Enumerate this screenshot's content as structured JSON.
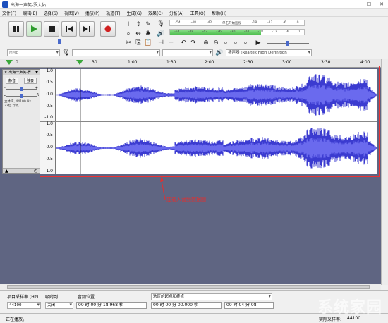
{
  "window": {
    "title": "出海一声笑-罗大佑"
  },
  "menu": [
    "文件(F)",
    "编辑(E)",
    "选择(S)",
    "视图(V)",
    "播放(P)",
    "轨道(T)",
    "生成(G)",
    "效果(C)",
    "分析(A)",
    "工具(O)",
    "帮助(H)"
  ],
  "toolbar": {
    "meter_top_scale": [
      "-54",
      "-48",
      "-42",
      "单击开始监视",
      "-18",
      "-12",
      "-6",
      "0"
    ],
    "meter_bottom_scale": [
      "-54",
      "-48",
      "-42",
      "-36",
      "-30",
      "-24",
      "-18",
      "-12",
      "-6",
      "0"
    ],
    "host": "MME",
    "output_device": "扬声器 (Realtek High Definition"
  },
  "ruler": {
    "labels": [
      "0",
      "30",
      "1:00",
      "1:30",
      "2:00",
      "2:30",
      "3:00",
      "3:30",
      "4:00"
    ]
  },
  "track": {
    "name": "出海一声笑-罗",
    "mute": "静音",
    "solo": "独奏",
    "gain_left": "-",
    "gain_right": "+",
    "pan_left": "L",
    "pan_right": "R",
    "info_line1": "立体声, 44100 Hz",
    "info_line2": "32位 浮点",
    "y_labels": [
      "1.0",
      "0.5",
      "0.0",
      "-0.5",
      "-1.0"
    ]
  },
  "annotation": {
    "text": "加载入音频数据图"
  },
  "selection": {
    "rate_label": "项目采样率 (Hz)",
    "rate_value": "44100",
    "snap_label": "吸附到",
    "snap_value": "关闭",
    "pos_label": "音频位置",
    "pos_value": "00 时 00 分 18.968 秒",
    "range_label": "选区的起点和终点",
    "start_value": "00 时 00 分 00.000 秒",
    "end_value": "00 时 04 分 08."
  },
  "status": {
    "left": "正在播放。",
    "right_label": "实际采样率:",
    "right_value": "44100"
  },
  "colors": {
    "waveform": "#3b3bd0",
    "waveform_rms": "#6a6aee",
    "track_bg": "#5f6582",
    "annotation": "#e03030"
  },
  "watermark": "系统家园"
}
